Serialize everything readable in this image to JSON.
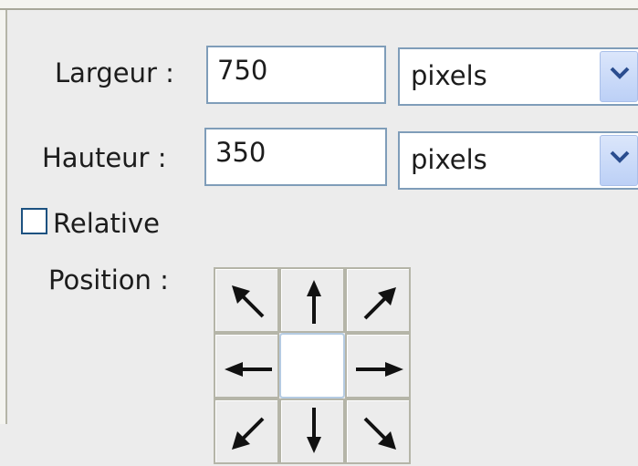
{
  "size": {
    "width_label": "Largeur :",
    "width_value": "750",
    "width_unit": "pixels",
    "height_label": "Hauteur :",
    "height_value": "350",
    "height_unit": "pixels"
  },
  "relative": {
    "label": "Relative",
    "checked": false
  },
  "anchor": {
    "label": "Position :",
    "cells": [
      {
        "icon": "arrow-up-left-icon"
      },
      {
        "icon": "arrow-up-icon"
      },
      {
        "icon": "arrow-up-right-icon"
      },
      {
        "icon": "arrow-left-icon"
      },
      {
        "icon": "anchor-center",
        "selected": true
      },
      {
        "icon": "arrow-right-icon"
      },
      {
        "icon": "arrow-down-left-icon"
      },
      {
        "icon": "arrow-down-icon"
      },
      {
        "icon": "arrow-down-right-icon"
      }
    ]
  },
  "colors": {
    "field_border": "#7f9db9",
    "checkbox_border": "#1c5180",
    "dropdown_button": "#bcd0f6"
  }
}
